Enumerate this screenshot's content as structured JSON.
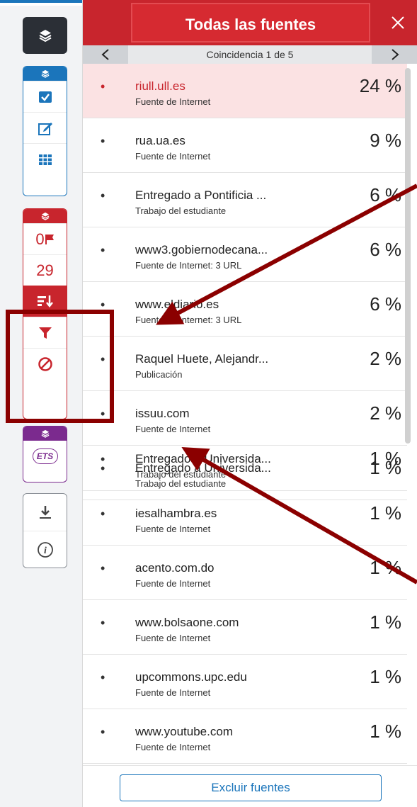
{
  "header": {
    "title": "Todas las fuentes",
    "close_icon": "close-icon"
  },
  "match_nav": {
    "prev_icon": "chevron-left-icon",
    "label": "Coincidencia 1 de 5",
    "next_icon": "chevron-right-icon"
  },
  "sources": [
    {
      "name": "riull.ull.es",
      "type": "Fuente de Internet",
      "percent": "24 %",
      "active": true
    },
    {
      "name": "rua.ua.es",
      "type": "Fuente de Internet",
      "percent": "9 %"
    },
    {
      "name": "Entregado a Pontificia ...",
      "type": "Trabajo del estudiante",
      "percent": "6 %"
    },
    {
      "name": "www3.gobiernodecana...",
      "type": "Fuente de Internet: 3 URL",
      "percent": "6 %"
    },
    {
      "name": "www.eldiario.es",
      "type": "Fuente de Internet: 3 URL",
      "percent": "6 %"
    },
    {
      "name": "Raquel Huete, Alejandr...",
      "type": "Publicación",
      "percent": "2 %"
    },
    {
      "name": "issuu.com",
      "type": "Fuente de Internet",
      "percent": "2 %"
    },
    {
      "name": "Entregado a Universida...",
      "type": "Trabajo del estudiante",
      "percent": "1 %"
    },
    {
      "name": "iesalhambra.es",
      "type": "Fuente de Internet",
      "percent": "1 %"
    },
    {
      "name": "acento.com.do",
      "type": "Fuente de Internet",
      "percent": "1 %"
    },
    {
      "name": "www.bolsaone.com",
      "type": "Fuente de Internet",
      "percent": "1 %"
    },
    {
      "name": "upcommons.upc.edu",
      "type": "Fuente de Internet",
      "percent": "1 %"
    },
    {
      "name": "www.youtube.com",
      "type": "Fuente de Internet",
      "percent": "1 %"
    }
  ],
  "footer": {
    "exclude_label": "Excluir fuentes"
  },
  "toolbar": {
    "layers_icon": "layers-icon",
    "group_blue": {
      "color": "#1b75bb",
      "items": [
        "checkbox-icon",
        "edit-icon",
        "grid-icon"
      ]
    },
    "group_red": {
      "color": "#c8252d",
      "flag_count": "0",
      "similarity": "29",
      "items": [
        "sort-icon",
        "filter-icon",
        "exclude-icon"
      ]
    },
    "group_purple": {
      "color": "#7b2a8e",
      "ets_label": "ETS"
    },
    "group_gray": {
      "items": [
        "download-icon",
        "info-icon"
      ]
    }
  },
  "colors": {
    "accent_red": "#c8252d",
    "accent_blue": "#1b75bb",
    "annotation": "#8b0000"
  }
}
